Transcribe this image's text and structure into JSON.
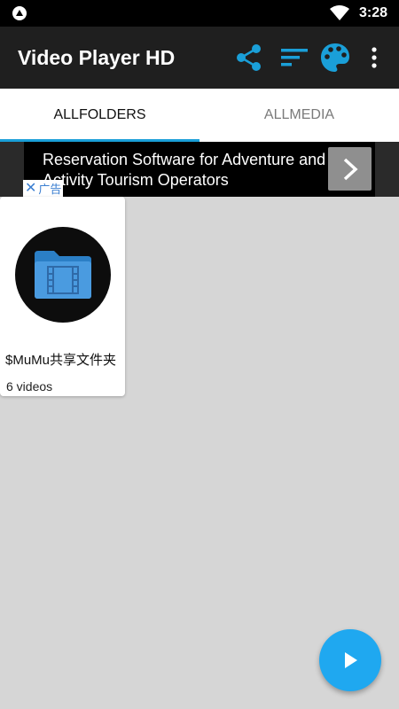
{
  "status_bar": {
    "time": "3:28",
    "icons": [
      "notification-icon",
      "wifi-icon",
      "battery-icon"
    ]
  },
  "app_bar": {
    "title": "Video Player HD",
    "actions": [
      "share-icon",
      "sort-icon",
      "palette-icon",
      "more-icon"
    ],
    "accent_color": "#1a9fd8"
  },
  "tabs": [
    {
      "label": "ALLFOLDERS",
      "selected": true
    },
    {
      "label": "ALLMEDIA",
      "selected": false
    }
  ],
  "ad": {
    "text": "Reservation Software for Adventure and Activity Tourism Operators",
    "badge": "广告",
    "close_glyph": "✕"
  },
  "folders": [
    {
      "name": "$MuMu共享文件夹",
      "count": "6 videos"
    }
  ],
  "fab": {
    "icon": "play-icon",
    "color": "#1fa8f0"
  }
}
